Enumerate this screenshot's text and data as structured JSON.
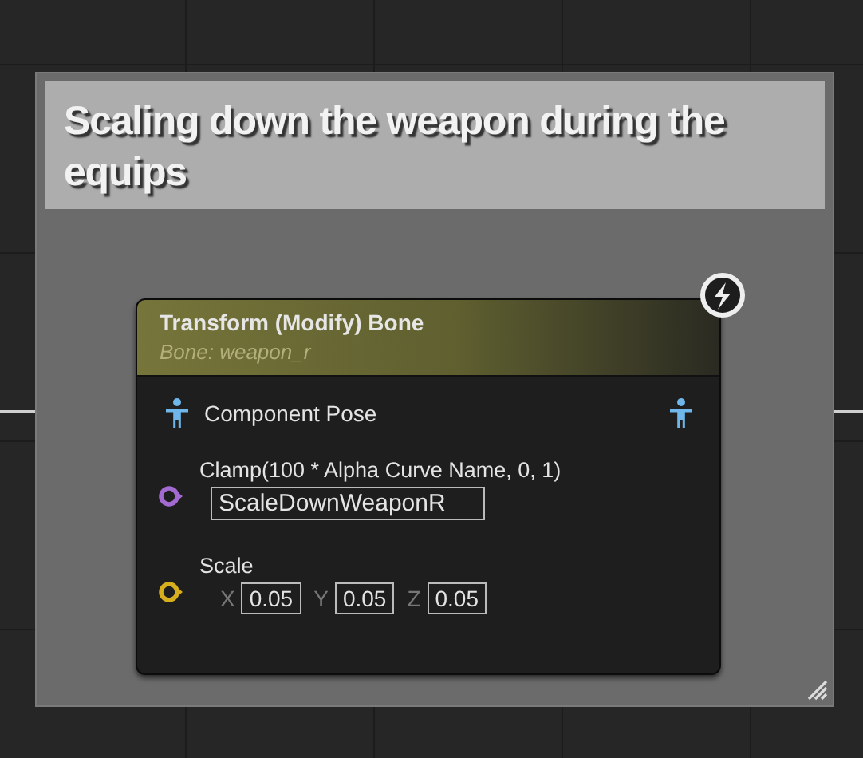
{
  "comment": {
    "title": "Scaling down the weapon during the equips"
  },
  "node": {
    "title": "Transform (Modify) Bone",
    "subtitle": "Bone: weapon_r",
    "pose_pin": {
      "label": "Component Pose"
    },
    "pins": [
      {
        "kind": "name",
        "label": "Clamp(100 * Alpha Curve Name, 0, 1)",
        "value": "ScaleDownWeaponR",
        "color": "#a36bd1"
      },
      {
        "kind": "vector",
        "label": "Scale",
        "color": "#d6ae1e",
        "axes": [
          {
            "axis": "X",
            "value": "0.05"
          },
          {
            "axis": "Y",
            "value": "0.05"
          },
          {
            "axis": "Z",
            "value": "0.05"
          }
        ]
      }
    ]
  }
}
